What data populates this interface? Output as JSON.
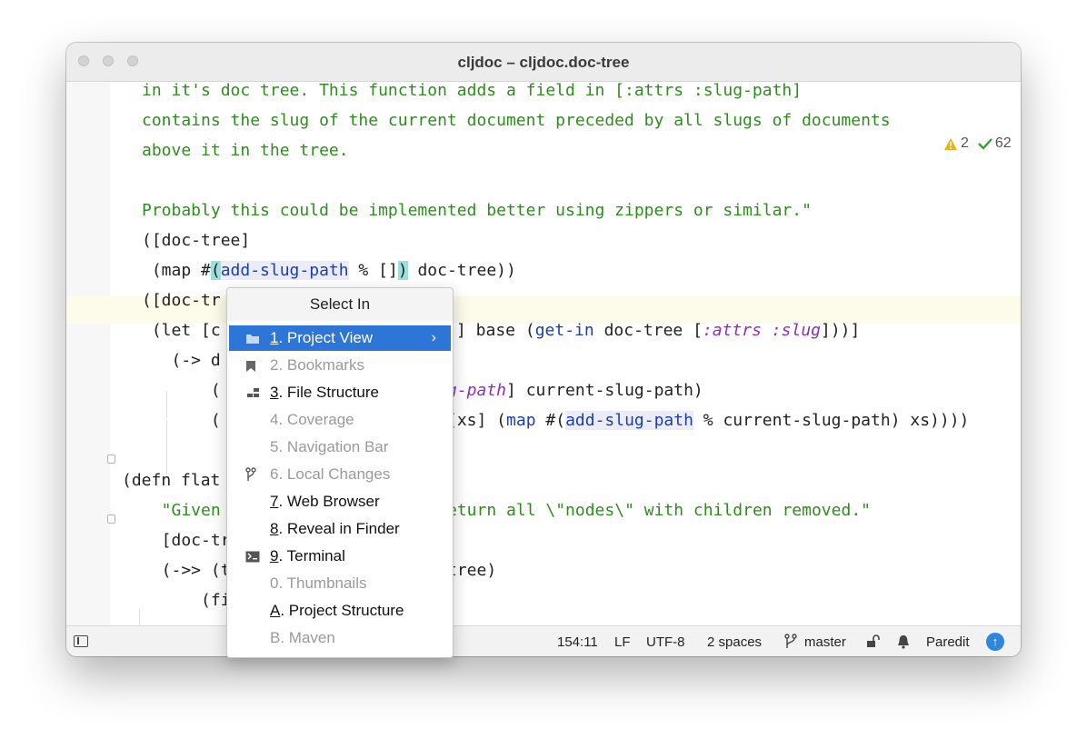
{
  "window": {
    "title": "cljdoc – cljdoc.doc-tree"
  },
  "inspections": {
    "warnings": "2",
    "ok": "62"
  },
  "code": {
    "l1": "in it's doc tree. This function adds a field in [:attrs :slug-path]",
    "l2": "contains the slug of the current document preceded by all slugs of documents",
    "l3": "above it in the tree.",
    "l5": "Probably this could be implemented better using zippers or similar.\"",
    "l6": "([doc-tree]",
    "l7": {
      "pre": " (map #",
      "p1": "(",
      "f": "add-slug-path",
      "mid": " % []",
      "p2": ")",
      "post": " doc-tree))"
    },
    "l8": "([doc-tr",
    "l9": {
      "a": " (let [c",
      "b": "] base (",
      "c": "get-in",
      "d": " doc-tree [",
      "e": ":attrs :slug",
      "f": "]))]"
    },
    "l10": "   (-> d",
    "l11": {
      "a": "       (",
      "b": "g-path",
      "c": "] current-slug-path)"
    },
    "l12": {
      "a": "       (",
      "b": "[xs] (",
      "c": "map",
      "d": " #(",
      "e": "add-slug-path",
      "f": " % current-slug-path) xs))))"
    },
    "l14": "(defn flat",
    "l15": {
      "a": "  \"Given a",
      "b": "eturn all \\\"nodes\\\" with children removed.\""
    },
    "l16": "  [doc-tre",
    "l17": {
      "a": "  (->> (tr",
      "b": "tree)"
    },
    "l18": "      (fi"
  },
  "popup": {
    "title": "Select In",
    "items": [
      {
        "m": "1",
        "t": ". Project View"
      },
      {
        "m": "2",
        "t": ". Bookmarks"
      },
      {
        "m": "3",
        "t": ". File Structure"
      },
      {
        "m": "4",
        "t": ". Coverage"
      },
      {
        "m": "5",
        "t": ". Navigation Bar"
      },
      {
        "m": "6",
        "t": ". Local Changes"
      },
      {
        "m": "7",
        "t": ". Web Browser"
      },
      {
        "m": "8",
        "t": ". Reveal in Finder"
      },
      {
        "m": "9",
        "t": ". Terminal"
      },
      {
        "m": "0",
        "t": ". Thumbnails"
      },
      {
        "m": "A",
        "t": ". Project Structure"
      },
      {
        "m": "B",
        "t": ". Maven"
      }
    ]
  },
  "status": {
    "position": "154:11",
    "line_sep": "LF",
    "encoding": "UTF-8",
    "indent": "2 spaces",
    "branch": "master",
    "mode": "Paredit"
  },
  "colors": {
    "string": "#2f8c1f",
    "function": "#1b3fa9",
    "keyword": "#8a2fbf",
    "selection": "#2d75d6"
  }
}
